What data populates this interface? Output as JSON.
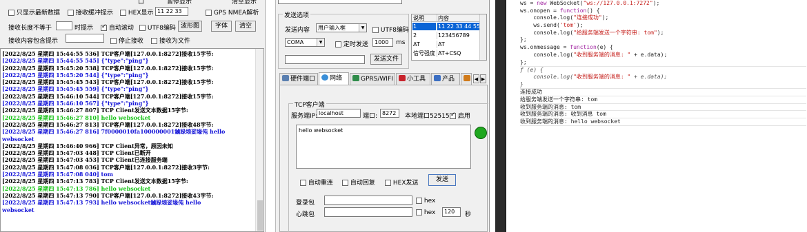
{
  "left": {
    "settings_top_row_partial": [
      "口",
      "暂停显示",
      "清空显示"
    ],
    "checkbox_row1": [
      {
        "label": "只显示最新数据",
        "checked": false
      },
      {
        "label": "接收缓冲提示",
        "checked": false
      },
      {
        "label": "HEX显示",
        "checked": false
      },
      {
        "label": "GPS NMEA解析",
        "checked": false
      }
    ],
    "hex_value": "11 22 33",
    "row2": {
      "recv_len_label": "接收长度不等于",
      "timed_label": "时提示",
      "auto_scroll": {
        "label": "自动滚动",
        "checked": true
      },
      "utf8": {
        "label": "UTF8编码",
        "checked": false
      },
      "waveform_btn": "波形图",
      "font_btn": "字体",
      "clear_btn": "清空"
    },
    "row3": {
      "contains_label": "接收内容包含提示",
      "stop_recv": {
        "label": "停止接收",
        "checked": false
      },
      "save_file": {
        "label": "接收为文件",
        "checked": false
      }
    },
    "log": [
      {
        "text": "[2022/8/25 星期四 15:44:55 536]  TCP客户端[127.0.0.1:8272]接收15字节:",
        "color": "black"
      },
      {
        "text": "[2022/8/25 星期四 15:44:55 545]  {\"type\":\"ping\"}",
        "color": "blue"
      },
      {
        "text": "[2022/8/25 星期四 15:45:20 538]  TCP客户端[127.0.0.1:8272]接收15字节:",
        "color": "black"
      },
      {
        "text": "[2022/8/25 星期四 15:45:20 544]  {\"type\":\"ping\"}",
        "color": "blue"
      },
      {
        "text": "[2022/8/25 星期四 15:45:45 543]  TCP客户端[127.0.0.1:8272]接收15字节:",
        "color": "black"
      },
      {
        "text": "[2022/8/25 星期四 15:45:45 559]  {\"type\":\"ping\"}",
        "color": "blue"
      },
      {
        "text": "[2022/8/25 星期四 15:46:10 544]  TCP客户端[127.0.0.1:8272]接收15字节:",
        "color": "black"
      },
      {
        "text": "[2022/8/25 星期四 15:46:10 567]  {\"type\":\"ping\"}",
        "color": "blue"
      },
      {
        "text": "[2022/8/25 星期四 15:46:27 807]  TCP Client发送文本数据15字节:",
        "color": "black"
      },
      {
        "text": "[2022/8/25 星期四 15:46:27 810]  hello websocket",
        "color": "green"
      },
      {
        "text": "[2022/8/25 星期四 15:46:27 813]  TCP客户端[127.0.0.1:8272]接收48字节:",
        "color": "black"
      },
      {
        "text": "[2022/8/25 星期四 15:46:27 816]   7f0000010fa100000001鏀跺埌娑堟伅 hello",
        "color": "blue"
      },
      {
        "text": "websocket",
        "color": "blue"
      },
      {
        "text": "[2022/8/25 星期四 15:46:40 966]  TCP Client异常，原因未知",
        "color": "black"
      },
      {
        "text": "[2022/8/25 星期四 15:47:03 448]  TCP Client已断开",
        "color": "black"
      },
      {
        "text": "[2022/8/25 星期四 15:47:03 453]  TCP Client已连接服务端",
        "color": "black"
      },
      {
        "text": "[2022/8/25 星期四 15:47:08 036]  TCP客户端[127.0.0.1:8272]接收3字节:",
        "color": "black"
      },
      {
        "text": "[2022/8/25 星期四 15:47:08 040]  tom",
        "color": "blue"
      },
      {
        "text": "[2022/8/25 星期四 15:47:13 783]  TCP Client发送文本数据15字节:",
        "color": "black"
      },
      {
        "text": "[2022/8/25 星期四 15:47:13 786]  hello websocket",
        "color": "green"
      },
      {
        "text": "[2022/8/25 星期四 15:47:13 790]  TCP客户端[127.0.0.1:8272]接收43字节:",
        "color": "black"
      },
      {
        "text": "[2022/8/25 星期四 15:47:13 793]  hello websocket鏀跺埌娑堟伅 hello",
        "color": "blue"
      },
      {
        "text": "websocket",
        "color": "blue"
      }
    ]
  },
  "mid": {
    "send_options_title": "发送选项",
    "send_content_label": "发送内容",
    "send_content_value": "用户输入框",
    "utf8_label": "UTF8编码",
    "coma_value": "COMA",
    "timed_send_label": "定时发送",
    "interval_value": "1000",
    "interval_unit": "ms",
    "send_file_btn": "发送文件",
    "cmd_table": {
      "headers": [
        "说明",
        "内容"
      ],
      "rows": [
        {
          "c1": "1",
          "c2": "11 22 33 44 55",
          "selected": true
        },
        {
          "c1": "2",
          "c2": "123456789",
          "selected": false
        },
        {
          "c1": "AT",
          "c2": "AT",
          "selected": false
        },
        {
          "c1": "信号强度",
          "c2": "AT+CSQ",
          "selected": false
        }
      ]
    },
    "tabs": [
      "硬件端口",
      "网络",
      "GPRS/WIFI",
      "小工具",
      "产品"
    ],
    "tcp": {
      "group_title": "TCP客户端",
      "server_ip_label": "服务端IP:",
      "server_ip_value": "localhost",
      "port_label": "端口:",
      "port_value": "8272",
      "local_port_label": "本地端口52515",
      "enable_label": "启用",
      "recv_text": "hello websocket",
      "auto_reconnect": "自动重连",
      "auto_reply": "自动回复",
      "hex_send": "HEX发送",
      "send_btn": "发送",
      "login_label": "登录包",
      "heartbeat_label": "心跳包",
      "hex_label": "hex",
      "heartbeat_interval": "120",
      "seconds_unit": "秒"
    }
  },
  "console": {
    "lines": [
      {
        "kind": "code",
        "parts": [
          {
            "t": "ws = ",
            "c": ""
          },
          {
            "t": "new",
            "c": "kw"
          },
          {
            "t": " WebSocket(",
            "c": ""
          },
          {
            "t": "\"ws://127.0.0.1:7272\"",
            "c": "str"
          },
          {
            "t": ");",
            "c": ""
          }
        ]
      },
      {
        "kind": "code",
        "parts": [
          {
            "t": "ws.onopen = ",
            "c": ""
          },
          {
            "t": "function",
            "c": "kw"
          },
          {
            "t": "() {",
            "c": ""
          }
        ]
      },
      {
        "kind": "code",
        "parts": [
          {
            "t": "    console.log(",
            "c": ""
          },
          {
            "t": "\"连接成功\"",
            "c": "str"
          },
          {
            "t": ");",
            "c": ""
          }
        ]
      },
      {
        "kind": "code",
        "parts": [
          {
            "t": "    ws.send(",
            "c": ""
          },
          {
            "t": "'tom'",
            "c": "str"
          },
          {
            "t": ");",
            "c": ""
          }
        ]
      },
      {
        "kind": "code",
        "parts": [
          {
            "t": "    console.log(",
            "c": ""
          },
          {
            "t": "\"给服务端发送一个字符串: tom\"",
            "c": "str"
          },
          {
            "t": ");",
            "c": ""
          }
        ]
      },
      {
        "kind": "code",
        "parts": [
          {
            "t": "};",
            "c": ""
          }
        ]
      },
      {
        "kind": "code",
        "parts": [
          {
            "t": "ws.onmessage = ",
            "c": ""
          },
          {
            "t": "function",
            "c": "kw"
          },
          {
            "t": "(e) {",
            "c": ""
          }
        ]
      },
      {
        "kind": "code",
        "parts": [
          {
            "t": "    console.log(",
            "c": ""
          },
          {
            "t": "\"收到服务端的消息: \"",
            "c": "str"
          },
          {
            "t": " + e.data);",
            "c": ""
          }
        ]
      },
      {
        "kind": "code",
        "parts": [
          {
            "t": "};",
            "c": ""
          }
        ]
      },
      {
        "kind": "result",
        "parts": [
          {
            "t": "ƒ (e) {",
            "c": "fn-out"
          }
        ]
      },
      {
        "kind": "result",
        "parts": [
          {
            "t": "    console.log(",
            "c": "fn-out"
          },
          {
            "t": "\"收到服务端的消息: \"",
            "c": "str"
          },
          {
            "t": " + e.data);",
            "c": "fn-out"
          }
        ]
      },
      {
        "kind": "result",
        "parts": [
          {
            "t": "}",
            "c": "fn-out"
          }
        ]
      },
      {
        "kind": "log",
        "parts": [
          {
            "t": "连接成功",
            "c": ""
          }
        ]
      },
      {
        "kind": "log",
        "parts": [
          {
            "t": "给服务端发送一个字符串: tom",
            "c": ""
          }
        ]
      },
      {
        "kind": "log",
        "parts": [
          {
            "t": "收到服务端的消息: tom",
            "c": ""
          }
        ]
      },
      {
        "kind": "log",
        "parts": [
          {
            "t": "收到服务端的消息: 收到消息 tom",
            "c": ""
          }
        ]
      },
      {
        "kind": "log",
        "parts": [
          {
            "t": "收到服务端的消息: hello websocket",
            "c": ""
          }
        ]
      },
      {
        "kind": "prompt",
        "parts": [
          {
            "t": "",
            "c": ""
          }
        ]
      }
    ],
    "colors": {
      "prompt": "#1a73e8",
      "string": "#c41a16",
      "keyword": "#a022a0"
    }
  }
}
